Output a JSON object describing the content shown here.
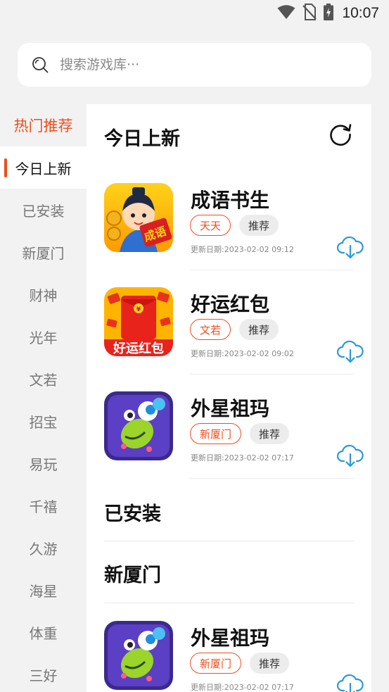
{
  "status": {
    "time": "10:07"
  },
  "search": {
    "placeholder": "搜索游戏库···"
  },
  "sidebar": {
    "items": [
      {
        "label": "热门推荐"
      },
      {
        "label": "今日上新"
      },
      {
        "label": "已安装"
      },
      {
        "label": "新厦门"
      },
      {
        "label": "财神"
      },
      {
        "label": "光年"
      },
      {
        "label": "文若"
      },
      {
        "label": "招宝"
      },
      {
        "label": "易玩"
      },
      {
        "label": "千禧"
      },
      {
        "label": "久游"
      },
      {
        "label": "海星"
      },
      {
        "label": "体重"
      },
      {
        "label": "三好"
      }
    ]
  },
  "sections": {
    "today": {
      "title": "今日上新"
    },
    "installed": {
      "title": "已安装"
    },
    "xinxiamen": {
      "title": "新厦门"
    }
  },
  "apps": [
    {
      "name": "成语书生",
      "tag1": "天天",
      "tag2": "推荐",
      "date": "更新日期:2023-02-02 09:12",
      "icon": "chengyu-shusheng-app-icon",
      "icon_text": "成语"
    },
    {
      "name": "好运红包",
      "tag1": "文若",
      "tag2": "推荐",
      "date": "更新日期:2023-02-02 09:02",
      "icon": "haoyun-hongbao-app-icon",
      "icon_text": "好运红包"
    },
    {
      "name": "外星祖玛",
      "tag1": "新厦门",
      "tag2": "推荐",
      "date": "更新日期:2023-02-02 07:17",
      "icon": "alien-zuma-app-icon"
    },
    {
      "name": "外星祖玛",
      "tag1": "新厦门",
      "tag2": "推荐",
      "date": "更新日期:2023-02-02 07:17",
      "icon": "alien-zuma-app-icon"
    }
  ],
  "colors": {
    "accent": "#ee4e1d",
    "download": "#2a9ad8",
    "background": "#f2f2f2"
  }
}
